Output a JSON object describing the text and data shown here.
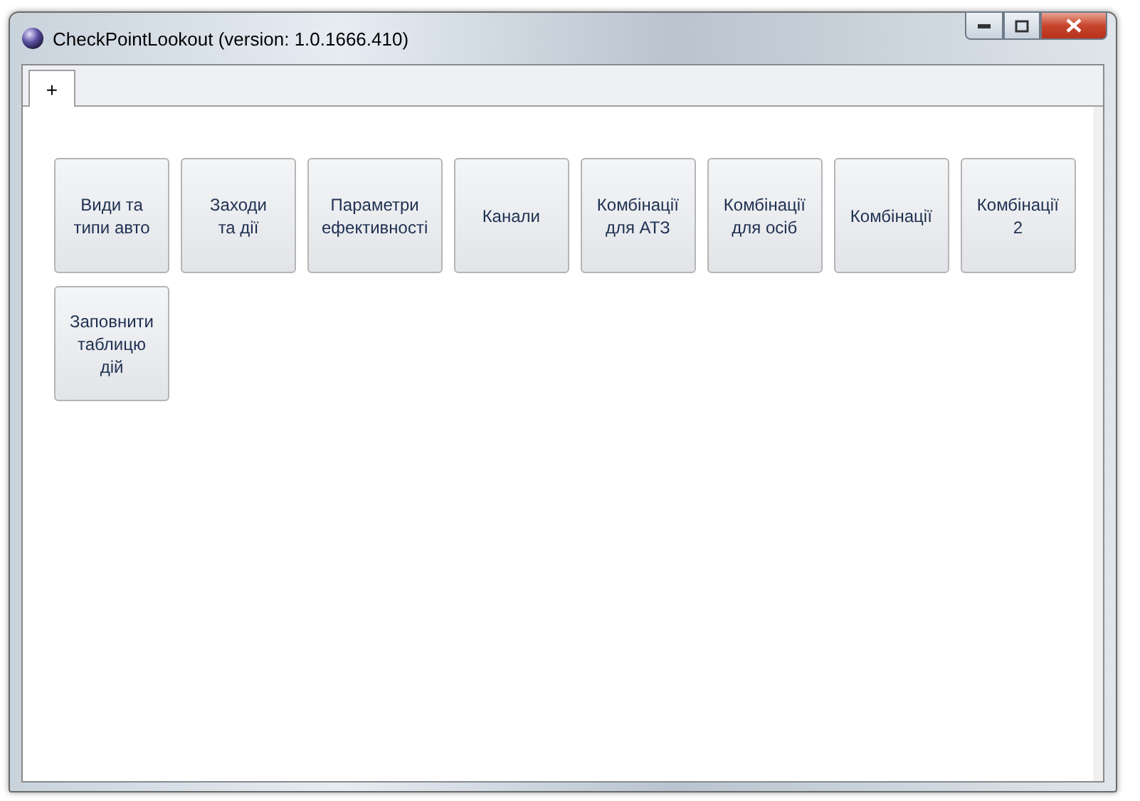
{
  "window": {
    "title": "CheckPointLookout (version: 1.0.1666.410)"
  },
  "tabs": [
    {
      "label": "+",
      "selected": true
    }
  ],
  "buttons": [
    {
      "label": "Види та\nтипи авто"
    },
    {
      "label": "Заходи\nта дії"
    },
    {
      "label": "Параметри\nефективності"
    },
    {
      "label": "Канали"
    },
    {
      "label": "Комбінації\nдля АТЗ"
    },
    {
      "label": "Комбінації\nдля осіб"
    },
    {
      "label": "Комбінації"
    },
    {
      "label": "Комбінації\n2"
    },
    {
      "label": "Заповнити\nтаблицю\nдій"
    }
  ]
}
